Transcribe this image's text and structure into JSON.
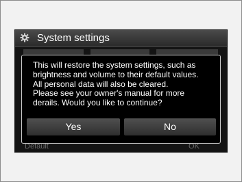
{
  "header": {
    "title": "System settings",
    "icon": "gear-icon"
  },
  "background": {
    "default_label": "Default",
    "ok_label": "OK"
  },
  "dialog": {
    "message_lines": [
      "This will restore the system settings, such as",
      "brightness and volume to their default values.",
      "All personal data will also be cleared.",
      "Please see your owner's manual for more",
      "derails. Would you like to continue?"
    ],
    "yes_label": "Yes",
    "no_label": "No"
  },
  "colors": {
    "screen_background": "#000000",
    "text": "#ffffff",
    "button": "#404040",
    "dialog_border": "#c8c8c8"
  }
}
